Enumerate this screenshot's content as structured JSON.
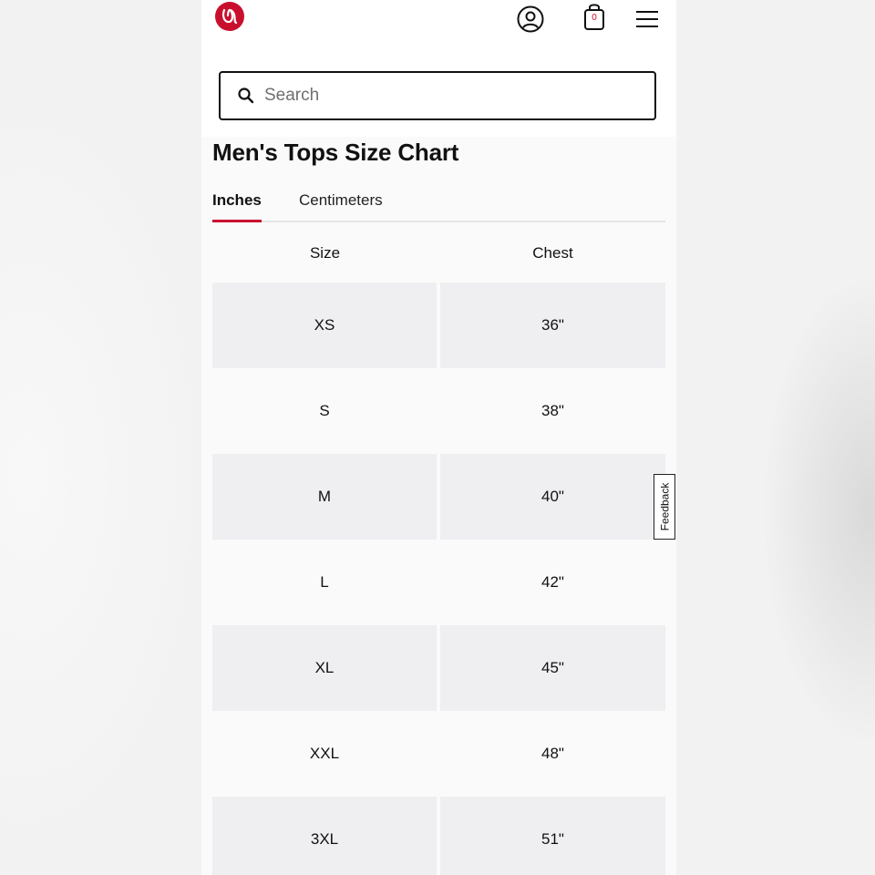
{
  "header": {
    "logo_alt": "lululemon",
    "account_icon": "account-circle-icon",
    "bag_icon": "shopping-bag-icon",
    "bag_count": "0",
    "menu_icon": "hamburger-menu-icon"
  },
  "search": {
    "placeholder": "Search",
    "value": ""
  },
  "page": {
    "title": "Men's Tops Size Chart"
  },
  "tabs": [
    {
      "label": "Inches",
      "active": true
    },
    {
      "label": "Centimeters",
      "active": false
    }
  ],
  "size_table": {
    "headers": {
      "size": "Size",
      "chest": "Chest"
    },
    "rows": [
      {
        "size": "XS",
        "chest": "36\""
      },
      {
        "size": "S",
        "chest": "38\""
      },
      {
        "size": "M",
        "chest": "40\""
      },
      {
        "size": "L",
        "chest": "42\""
      },
      {
        "size": "XL",
        "chest": "45\""
      },
      {
        "size": "XXL",
        "chest": "48\""
      },
      {
        "size": "3XL",
        "chest": "51\""
      }
    ]
  },
  "feedback": {
    "label": "Feedback"
  },
  "colors": {
    "accent": "#c8102e",
    "row_shade": "#efeff2",
    "text": "#111111"
  }
}
